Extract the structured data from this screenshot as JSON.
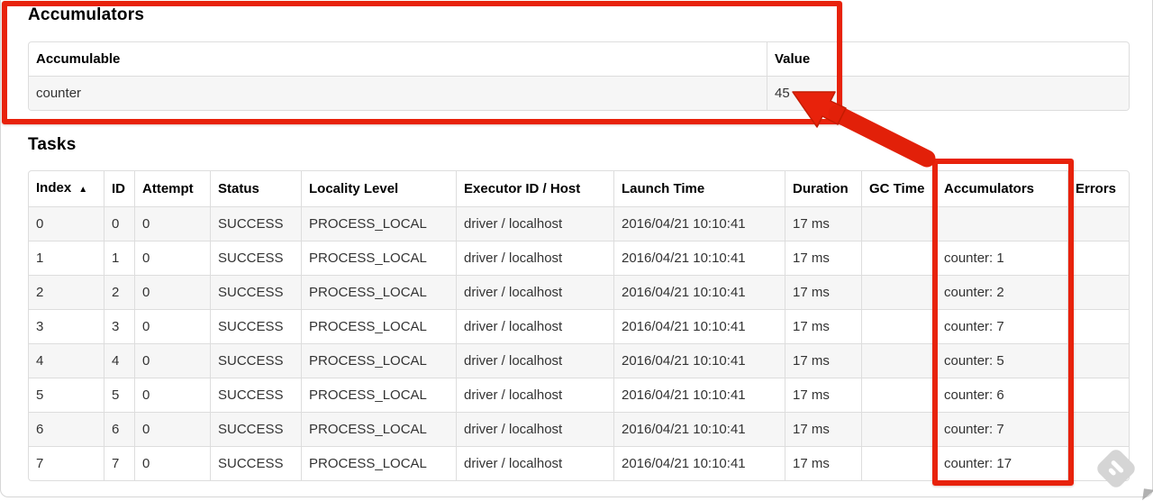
{
  "annotation_color": "#e8220b",
  "annotation_edge_color": "#c41c02",
  "accumulators": {
    "heading": "Accumulators",
    "columns": {
      "accumulable": "Accumulable",
      "value": "Value"
    },
    "rows": [
      {
        "accumulable": "counter",
        "value": "45"
      }
    ]
  },
  "tasks": {
    "heading": "Tasks",
    "columns": {
      "index": "Index",
      "id": "ID",
      "attempt": "Attempt",
      "status": "Status",
      "locality_level": "Locality Level",
      "executor_id_host": "Executor ID / Host",
      "launch_time": "Launch Time",
      "duration": "Duration",
      "gc_time": "GC Time",
      "accumulators": "Accumulators",
      "errors": "Errors"
    },
    "sort": {
      "column": "Index",
      "indicator": "▲"
    },
    "rows": [
      {
        "index": "0",
        "id": "0",
        "attempt": "0",
        "status": "SUCCESS",
        "locality_level": "PROCESS_LOCAL",
        "executor_id_host": "driver / localhost",
        "launch_time": "2016/04/21 10:10:41",
        "duration": "17 ms",
        "gc_time": "",
        "accumulators": "",
        "errors": ""
      },
      {
        "index": "1",
        "id": "1",
        "attempt": "0",
        "status": "SUCCESS",
        "locality_level": "PROCESS_LOCAL",
        "executor_id_host": "driver / localhost",
        "launch_time": "2016/04/21 10:10:41",
        "duration": "17 ms",
        "gc_time": "",
        "accumulators": "counter: 1",
        "errors": ""
      },
      {
        "index": "2",
        "id": "2",
        "attempt": "0",
        "status": "SUCCESS",
        "locality_level": "PROCESS_LOCAL",
        "executor_id_host": "driver / localhost",
        "launch_time": "2016/04/21 10:10:41",
        "duration": "17 ms",
        "gc_time": "",
        "accumulators": "counter: 2",
        "errors": ""
      },
      {
        "index": "3",
        "id": "3",
        "attempt": "0",
        "status": "SUCCESS",
        "locality_level": "PROCESS_LOCAL",
        "executor_id_host": "driver / localhost",
        "launch_time": "2016/04/21 10:10:41",
        "duration": "17 ms",
        "gc_time": "",
        "accumulators": "counter: 7",
        "errors": ""
      },
      {
        "index": "4",
        "id": "4",
        "attempt": "0",
        "status": "SUCCESS",
        "locality_level": "PROCESS_LOCAL",
        "executor_id_host": "driver / localhost",
        "launch_time": "2016/04/21 10:10:41",
        "duration": "17 ms",
        "gc_time": "",
        "accumulators": "counter: 5",
        "errors": ""
      },
      {
        "index": "5",
        "id": "5",
        "attempt": "0",
        "status": "SUCCESS",
        "locality_level": "PROCESS_LOCAL",
        "executor_id_host": "driver / localhost",
        "launch_time": "2016/04/21 10:10:41",
        "duration": "17 ms",
        "gc_time": "",
        "accumulators": "counter: 6",
        "errors": ""
      },
      {
        "index": "6",
        "id": "6",
        "attempt": "0",
        "status": "SUCCESS",
        "locality_level": "PROCESS_LOCAL",
        "executor_id_host": "driver / localhost",
        "launch_time": "2016/04/21 10:10:41",
        "duration": "17 ms",
        "gc_time": "",
        "accumulators": "counter: 7",
        "errors": ""
      },
      {
        "index": "7",
        "id": "7",
        "attempt": "0",
        "status": "SUCCESS",
        "locality_level": "PROCESS_LOCAL",
        "executor_id_host": "driver / localhost",
        "launch_time": "2016/04/21 10:10:41",
        "duration": "17 ms",
        "gc_time": "",
        "accumulators": "counter: 17",
        "errors": ""
      }
    ]
  }
}
